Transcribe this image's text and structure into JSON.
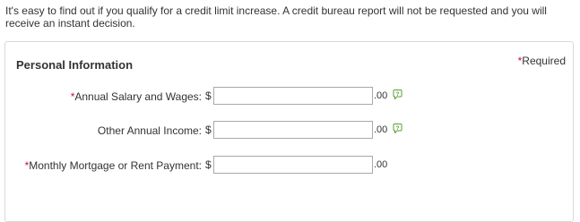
{
  "intro": {
    "text": "It's easy to find out if you qualify for a credit limit increase. A credit bureau report will not be requested and you will receive an instant decision."
  },
  "panel": {
    "title": "Personal Information",
    "required_asterisk": "*",
    "required_label": "Required"
  },
  "fields": [
    {
      "asterisk": "*",
      "label": "Annual Salary and Wages:",
      "currency": "$",
      "value": "",
      "cents": ".00",
      "help_icon": "chat-help-icon"
    },
    {
      "asterisk": "",
      "label": "Other Annual Income:",
      "currency": "$",
      "value": "",
      "cents": ".00",
      "help_icon": "chat-help-icon"
    },
    {
      "asterisk": "*",
      "label": "Monthly Mortgage or Rent Payment:",
      "currency": "$",
      "value": "",
      "cents": ".00"
    }
  ],
  "colors": {
    "required_asterisk": "#c8102e",
    "help_icon": "#5aa02c",
    "panel_border": "#d9d9d9"
  }
}
